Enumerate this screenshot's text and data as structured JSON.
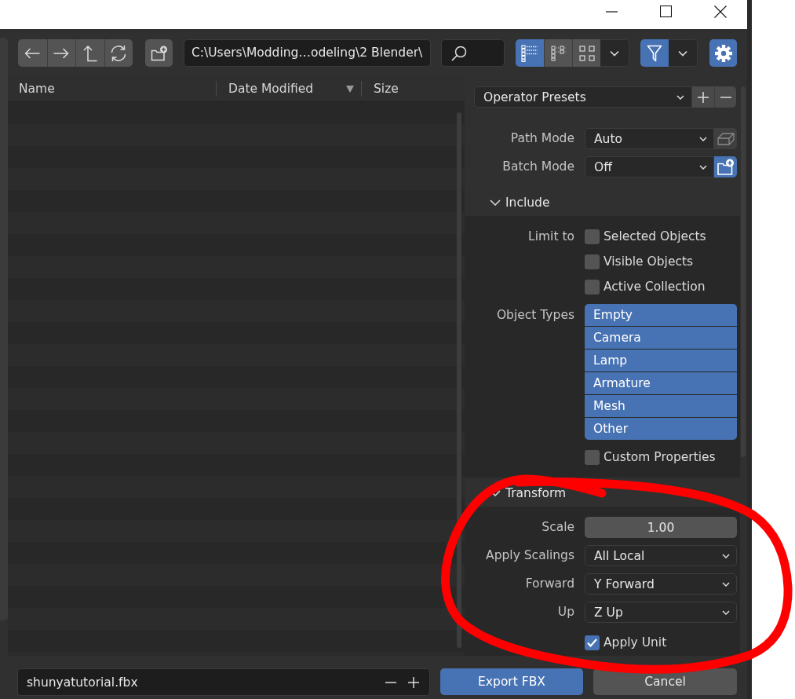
{
  "toolbar": {
    "path": "C:\\Users\\Modding…odeling\\2 Blender\\",
    "view_modes": [
      {
        "kind": "vertical-list",
        "selected": true
      },
      {
        "kind": "horizontal-list",
        "selected": false
      },
      {
        "kind": "thumbnails",
        "selected": false
      }
    ],
    "filter": {
      "on": true
    },
    "settings": {
      "on": true
    }
  },
  "file_list": {
    "columns": [
      {
        "label": "Name",
        "sorted": false
      },
      {
        "label": "Date Modified",
        "sorted": true
      },
      {
        "label": "Size",
        "sorted": false
      }
    ]
  },
  "sidebar": {
    "presets": "Operator Presets",
    "rows": [
      {
        "kind": "dropdown",
        "label": "Path Mode",
        "value": "Auto",
        "toggle": {
          "kind": "box",
          "on": false
        }
      },
      {
        "kind": "dropdown",
        "label": "Batch Mode",
        "value": "Off",
        "toggle": {
          "kind": "folder",
          "on": true
        }
      }
    ],
    "sections": [
      {
        "title": "Include",
        "expanded": true,
        "rows": [
          {
            "kind": "checkboxes",
            "label": "Limit to",
            "items": [
              {
                "label": "Selected Objects",
                "checked": false
              },
              {
                "label": "Visible Objects",
                "checked": false
              },
              {
                "label": "Active Collection",
                "checked": false
              }
            ]
          },
          {
            "kind": "toggle-list",
            "label": "Object Types",
            "items": [
              {
                "label": "Empty",
                "selected": true
              },
              {
                "label": "Camera",
                "selected": true
              },
              {
                "label": "Lamp",
                "selected": true
              },
              {
                "label": "Armature",
                "selected": true
              },
              {
                "label": "Mesh",
                "selected": true
              },
              {
                "label": "Other",
                "selected": true
              }
            ]
          },
          {
            "kind": "checkboxes",
            "items": [
              {
                "label": "Custom Properties",
                "checked": false
              }
            ]
          }
        ]
      },
      {
        "title": "Transform",
        "expanded": true,
        "rows": [
          {
            "kind": "number",
            "label": "Scale",
            "value": "1.00"
          },
          {
            "kind": "dropdown",
            "label": "Apply Scalings",
            "value": "All Local"
          },
          {
            "kind": "dropdown",
            "label": "Forward",
            "value": "Y Forward"
          },
          {
            "kind": "dropdown",
            "label": "Up",
            "value": "Z Up"
          },
          {
            "kind": "checkboxes",
            "items": [
              {
                "label": "Apply Unit",
                "checked": true
              }
            ]
          }
        ]
      }
    ]
  },
  "footer": {
    "filename": "shunyatutorial.fbx",
    "buttons": [
      {
        "label": "Export FBX",
        "kind": "primary"
      },
      {
        "label": "Cancel",
        "kind": "secondary"
      }
    ]
  },
  "annotation": {
    "kind": "loop"
  }
}
